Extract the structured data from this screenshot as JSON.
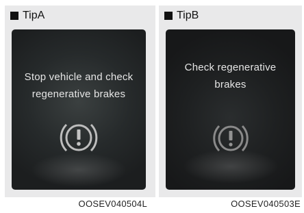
{
  "panels": [
    {
      "tip_label": "TipA",
      "message_line1": "Stop vehicle and check",
      "message_line2": "regenerative brakes",
      "icon": "brake-warning-icon",
      "figure_code": "OOSEV040504L"
    },
    {
      "tip_label": "TipB",
      "message_line1": "Check regenerative",
      "message_line2": "brakes",
      "icon": "brake-warning-icon",
      "figure_code": "OOSEV040503E"
    }
  ],
  "colors": {
    "panel_bg": "#e9e9ea",
    "screen_dark": "#1e2021",
    "text_light": "#e6e6e6"
  }
}
